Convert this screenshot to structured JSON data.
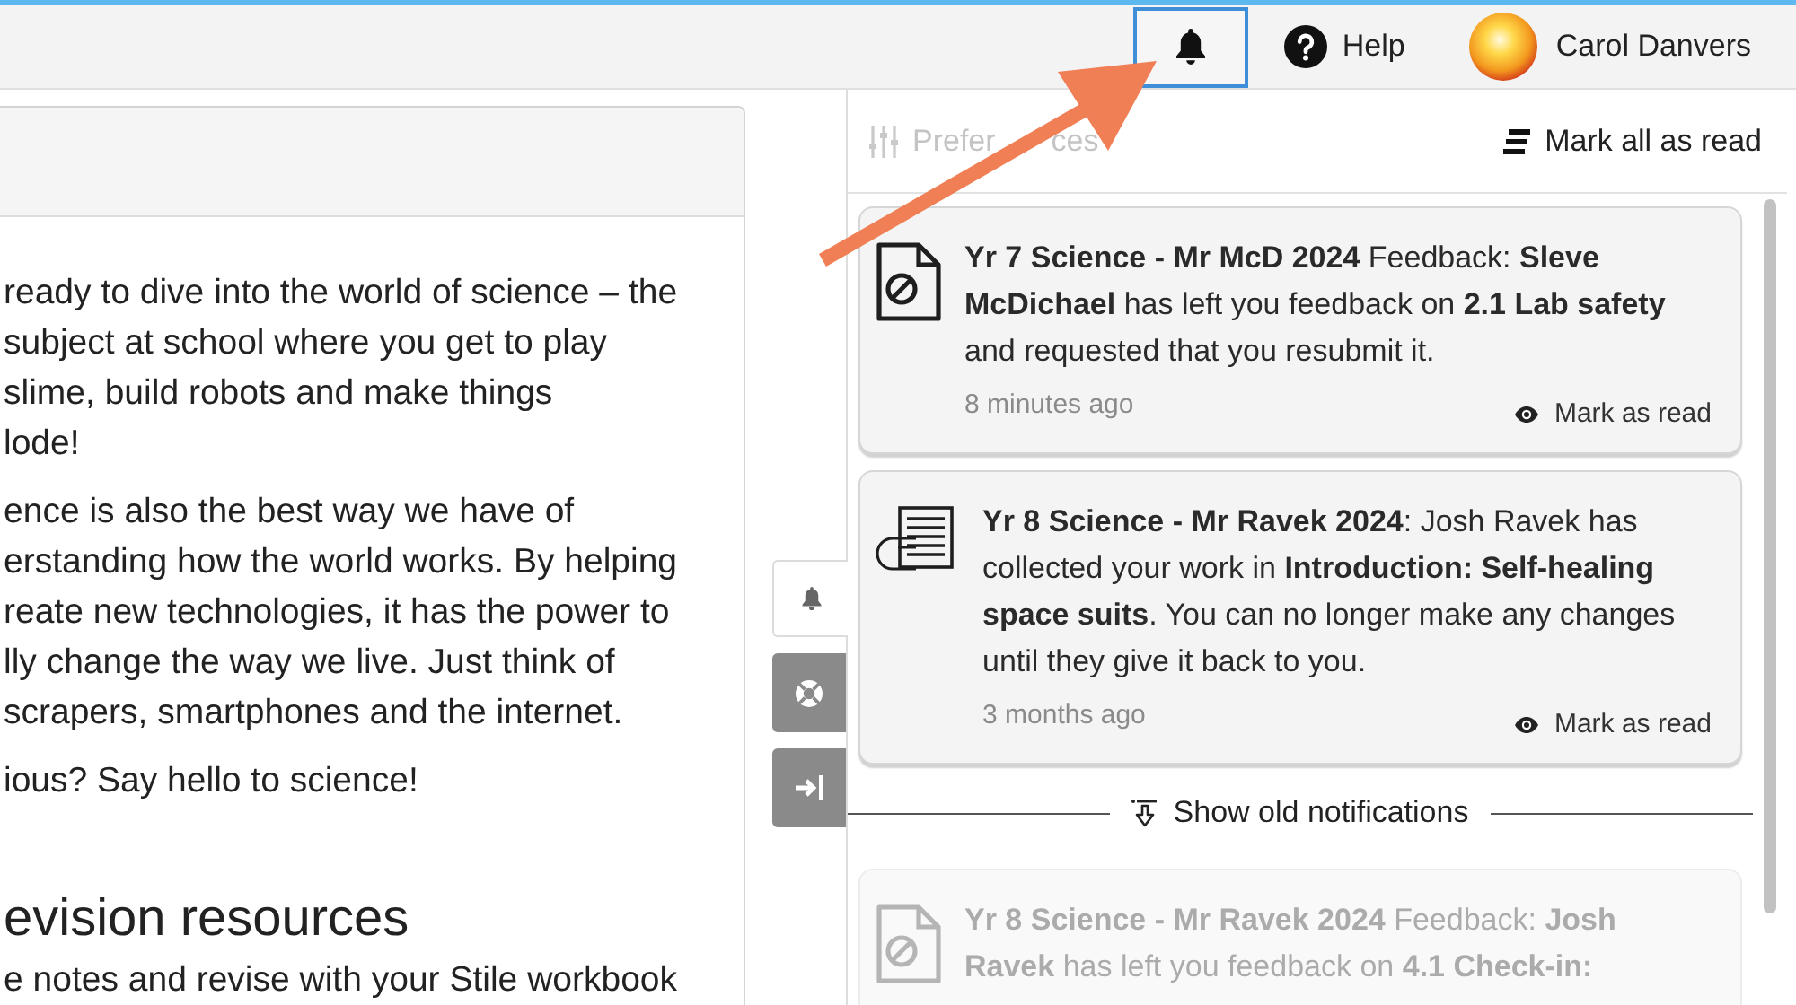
{
  "top_bar": {
    "notifications_button": {
      "selected": true
    },
    "help_label": "Help",
    "user": {
      "name": "Carol Danvers"
    }
  },
  "content": {
    "paragraphs": [
      [
        "ready to dive into the world of science – the",
        "subject at school where you get to play",
        "slime, build robots and make things",
        "lode!"
      ],
      [
        "ence is also the best way we have of",
        "erstanding how the world works. By helping",
        "reate new technologies, it has the power to",
        "lly change the way we live. Just think of",
        "scrapers, smartphones and the internet."
      ],
      [
        "ious? Say hello to science!"
      ]
    ],
    "heading": "evision resources",
    "after_heading": "e notes and revise with your Stile workbook"
  },
  "side_tabs": [
    {
      "kind": "notifications",
      "selected": true
    },
    {
      "kind": "help",
      "selected": false
    },
    {
      "kind": "collapse",
      "selected": false
    }
  ],
  "notifications_panel": {
    "preferences": {
      "label_parts": [
        "Prefer",
        "ces"
      ],
      "disabled": true
    },
    "mark_all_read": "Mark all as read",
    "notifications": [
      {
        "kind": "feedback",
        "read": false,
        "text": "**Yr 7 Science - Mr McD 2024** Feedback: **Sleve McDichael** has left you feedback on **2.1 Lab safety** and requested that you resubmit it.",
        "time": "8 minutes ago",
        "action": "Mark as read"
      },
      {
        "kind": "collected",
        "read": false,
        "text": "**Yr 8 Science - Mr Ravek 2024**: Josh Ravek has collected your work in **Introduction: Self-healing space suits**. You can no longer make any changes until they give it back to you.",
        "time": "3 months ago",
        "action": "Mark as read"
      }
    ],
    "show_old": "Show old notifications",
    "old_notifications": [
      {
        "kind": "feedback",
        "read": true,
        "text": "**Yr 8 Science - Mr Ravek 2024** Feedback: **Josh Ravek** has left you feedback on **4.1 Check-in:**"
      }
    ]
  }
}
